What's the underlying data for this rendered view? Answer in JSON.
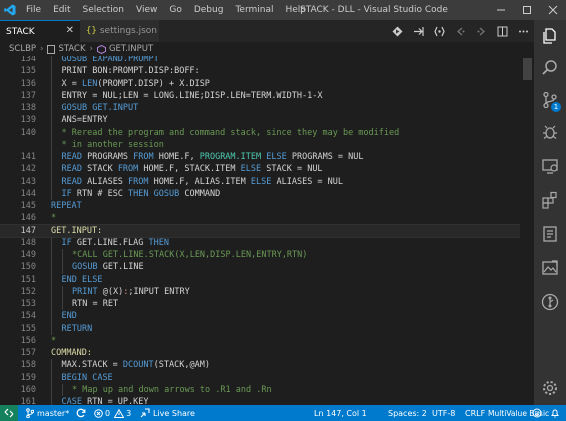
{
  "window": {
    "title": "STACK - DLL - Visual Studio Code"
  },
  "menu": [
    "File",
    "Edit",
    "Selection",
    "View",
    "Go",
    "Debug",
    "Terminal",
    "Help"
  ],
  "tabs": [
    {
      "label": "STACK",
      "active": true
    },
    {
      "label": "settings.json",
      "active": false
    }
  ],
  "breadcrumb": {
    "root": "SCLBP",
    "file": "STACK",
    "symbol": "GET.INPUT"
  },
  "activity": {
    "scm_badge": "1"
  },
  "editor": {
    "lines": [
      {
        "n": "134",
        "tokens": [
          [
            "GOSUB EXPAND.PROMPT",
            "k"
          ]
        ]
      },
      {
        "n": "135",
        "tokens": [
          [
            "PRINT BON:PROMPT.DISP:BOFF:",
            ""
          ]
        ]
      },
      {
        "n": "136",
        "tokens": [
          [
            "X = ",
            ""
          ],
          [
            "LEN",
            "k"
          ],
          [
            "(PROMPT.DISP) + X.DISP",
            ""
          ]
        ]
      },
      {
        "n": "137",
        "tokens": [
          [
            "ENTRY = NUL;LEN = LONG.LINE;DISP.LEN=TERM.WIDTH-1-X",
            ""
          ]
        ]
      },
      {
        "n": "138",
        "tokens": [
          [
            "GOSUB GET.INPUT",
            "k"
          ]
        ]
      },
      {
        "n": "139",
        "tokens": [
          [
            "ANS=ENTRY",
            ""
          ]
        ]
      },
      {
        "n": "140",
        "tokens": [
          [
            "* Reread the program and command stack, since they may be modified",
            "c"
          ]
        ]
      },
      {
        "n": "",
        "tokens": [
          [
            "* in another session",
            "c"
          ]
        ]
      },
      {
        "n": "141",
        "tokens": [
          [
            "READ",
            "k"
          ],
          [
            " PROGRAMS ",
            ""
          ],
          [
            "FROM",
            "k"
          ],
          [
            " HOME.F, ",
            ""
          ],
          [
            "PROGRAM.ITEM",
            "v"
          ],
          [
            " ",
            ""
          ],
          [
            "ELSE",
            "k"
          ],
          [
            " PROGRAMS = NUL",
            ""
          ]
        ]
      },
      {
        "n": "142",
        "tokens": [
          [
            "READ",
            "k"
          ],
          [
            " STACK ",
            ""
          ],
          [
            "FROM",
            "k"
          ],
          [
            " HOME.F, STACK.ITEM ",
            ""
          ],
          [
            "ELSE",
            "k"
          ],
          [
            " STACK = NUL",
            ""
          ]
        ]
      },
      {
        "n": "143",
        "tokens": [
          [
            "READ",
            "k"
          ],
          [
            " ALIASES ",
            ""
          ],
          [
            "FROM",
            "k"
          ],
          [
            " HOME.F, ALIAS.ITEM ",
            ""
          ],
          [
            "ELSE",
            "k"
          ],
          [
            " ALIASES = NUL",
            ""
          ]
        ]
      },
      {
        "n": "144",
        "tokens": [
          [
            "IF",
            "k"
          ],
          [
            " RTN # ESC ",
            ""
          ],
          [
            "THEN",
            "k"
          ],
          [
            " ",
            ""
          ],
          [
            "GOSUB",
            "k"
          ],
          [
            " COMMAND",
            ""
          ]
        ]
      },
      {
        "n": "145",
        "tokens": [
          [
            "REPEAT",
            "k"
          ]
        ]
      },
      {
        "n": "146",
        "tokens": [
          [
            "*",
            "c"
          ]
        ]
      },
      {
        "n": "147",
        "tokens": [
          [
            "GET.INPUT:",
            "l"
          ]
        ]
      },
      {
        "n": "148",
        "tokens": [
          [
            "IF",
            "k"
          ],
          [
            " GET.LINE.FLAG ",
            ""
          ],
          [
            "THEN",
            "k"
          ]
        ]
      },
      {
        "n": "149",
        "tokens": [
          [
            "*CALL GET.LINE.STACK(X,LEN,DISP.LEN,ENTRY,RTN)",
            "c"
          ]
        ]
      },
      {
        "n": "150",
        "tokens": [
          [
            "GOSUB",
            "k"
          ],
          [
            " GET.LINE",
            ""
          ]
        ]
      },
      {
        "n": "151",
        "tokens": [
          [
            "END ELSE",
            "k"
          ]
        ]
      },
      {
        "n": "152",
        "tokens": [
          [
            "PRINT ",
            "k"
          ],
          [
            "@(X)",
            ""
          ],
          [
            ":",
            "s"
          ],
          [
            ";INPUT ENTRY",
            ""
          ]
        ]
      },
      {
        "n": "153",
        "tokens": [
          [
            "RTN = RET",
            ""
          ]
        ]
      },
      {
        "n": "154",
        "tokens": [
          [
            "END",
            "k"
          ]
        ]
      },
      {
        "n": "155",
        "tokens": [
          [
            "RETURN",
            "k"
          ]
        ]
      },
      {
        "n": "156",
        "tokens": [
          [
            "*",
            "c"
          ]
        ]
      },
      {
        "n": "157",
        "tokens": [
          [
            "COMMAND:",
            "l"
          ]
        ]
      },
      {
        "n": "158",
        "tokens": [
          [
            "MAX.STACK = ",
            ""
          ],
          [
            "DCOUNT",
            "k"
          ],
          [
            "(STACK,@AM)",
            ""
          ]
        ]
      },
      {
        "n": "159",
        "tokens": [
          [
            "BEGIN CASE",
            "k"
          ]
        ]
      },
      {
        "n": "160",
        "tokens": [
          [
            "* Map up and down arrows to .R1 and .Rn",
            "c"
          ]
        ]
      },
      {
        "n": "161",
        "tokens": [
          [
            "CASE",
            "k"
          ],
          [
            " RTN = UP.KEY",
            ""
          ]
        ]
      }
    ],
    "indents": [
      1,
      1,
      1,
      1,
      1,
      1,
      1,
      1,
      1,
      1,
      1,
      1,
      0,
      0,
      0,
      1,
      2,
      2,
      1,
      2,
      2,
      1,
      1,
      0,
      0,
      1,
      1,
      2,
      1
    ],
    "current_line": "147"
  },
  "status": {
    "branch": "master*",
    "sync": "",
    "errors": "0",
    "warnings": "3",
    "liveshare": "Live Share",
    "position": "Ln 147, Col 1",
    "spaces": "Spaces: 2",
    "encoding": "UTF-8",
    "eol": "CRLF",
    "language": "MultiValue Basic"
  }
}
